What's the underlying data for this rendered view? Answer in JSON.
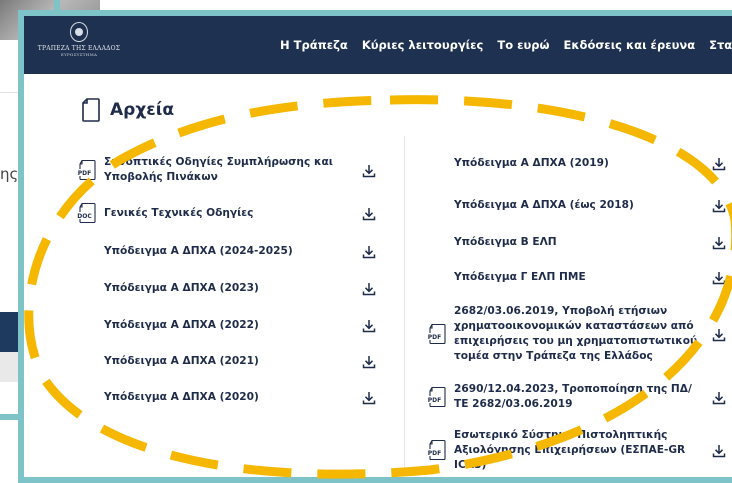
{
  "background": {
    "fragment_text": "ης"
  },
  "logo": {
    "title": "ΤΡΑΠΕΖΑ ΤΗΣ ΕΛΛΑΔΟΣ",
    "subtitle": "ΕΥΡΩΣΥΣΤΗΜΑ"
  },
  "nav": {
    "items": [
      {
        "label": "Η Τράπεζα"
      },
      {
        "label": "Κύριες λειτουργίες"
      },
      {
        "label": "Το ευρώ"
      },
      {
        "label": "Εκδόσεις και έρευνα"
      },
      {
        "label": "Στατιστικά σ"
      }
    ]
  },
  "section": {
    "title": "Αρχεία"
  },
  "files_left": [
    {
      "label": "Συνοπτικές Οδηγίες Συμπλήρωσης και Υποβολής Πινάκων",
      "type": "PDF"
    },
    {
      "label": "Γενικές Τεχνικές Οδηγίες",
      "type": "DOC"
    },
    {
      "label": "Υπόδειγμα Α ΔΠΧΑ (2024-2025)",
      "type": ""
    },
    {
      "label": "Υπόδειγμα Α ΔΠΧΑ (2023)",
      "type": ""
    },
    {
      "label": "Υπόδειγμα Α ΔΠΧΑ (2022)",
      "type": ""
    },
    {
      "label": "Υπόδειγμα Α ΔΠΧΑ (2021)",
      "type": ""
    },
    {
      "label": "Υπόδειγμα Α ΔΠΧΑ (2020)",
      "type": ""
    }
  ],
  "files_right": [
    {
      "label": "Υπόδειγμα Α ΔΠΧΑ (2019)",
      "type": ""
    },
    {
      "label": "Υπόδειγμα Α ΔΠΧΑ (έως 2018)",
      "type": ""
    },
    {
      "label": "Υπόδειγμα Β ΕΛΠ",
      "type": ""
    },
    {
      "label": "Υπόδειγμα Γ ΕΛΠ ΠΜΕ",
      "type": ""
    },
    {
      "label": "2682/03.06.2019, Υποβολή ετήσιων χρηματοοικονομικών καταστάσεων από επιχειρήσεις του μη χρηματοπιστωτικού τομέα στην Τράπεζα της Ελλάδος",
      "type": "PDF"
    },
    {
      "label": "2690/12.04.2023, Τροποποίηση της ΠΔ/ΤΕ 2682/03.06.2019",
      "type": "PDF"
    },
    {
      "label": "Εσωτερικό Σύστημα Πιστοληπτικής Αξιολόγησης Επιχειρήσεων (ΕΣΠΑΕ-GR ICAS)",
      "type": "PDF"
    }
  ],
  "colors": {
    "navbar": "#1f3150",
    "frame": "#7ec3c8",
    "text": "#1e2b4a",
    "annotation": "#f5b700"
  }
}
